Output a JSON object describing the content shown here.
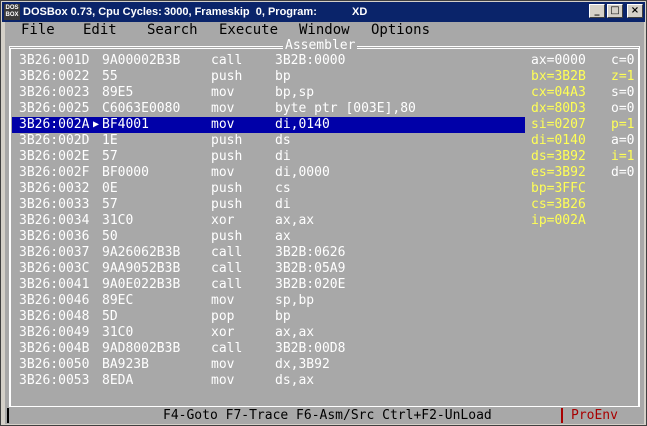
{
  "titlebar": {
    "icon_text": [
      "DOS",
      "BOX"
    ],
    "segments": [
      "DOSBox 0.73, Cpu Cycles:",
      "3000, Frameskip  0, Program:",
      "XD"
    ],
    "buttons": [
      "_",
      "□",
      "×"
    ]
  },
  "menu": [
    "File",
    "Edit",
    "Search",
    "Execute",
    "Window",
    "Options"
  ],
  "panel_title": "Assembler",
  "instructions": [
    {
      "addr": "3B26:001D",
      "bytes": "9A00002B3B",
      "mnem": "call",
      "ops": "3B2B:0000"
    },
    {
      "addr": "3B26:0022",
      "bytes": "55",
      "mnem": "push",
      "ops": "bp"
    },
    {
      "addr": "3B26:0023",
      "bytes": "89E5",
      "mnem": "mov",
      "ops": "bp,sp"
    },
    {
      "addr": "3B26:0025",
      "bytes": "C6063E0080",
      "mnem": "mov",
      "ops": "byte ptr [003E],80"
    },
    {
      "addr": "3B26:002A",
      "bytes": "BF4001",
      "mnem": "mov",
      "ops": "di,0140",
      "selected": true
    },
    {
      "addr": "3B26:002D",
      "bytes": "1E",
      "mnem": "push",
      "ops": "ds"
    },
    {
      "addr": "3B26:002E",
      "bytes": "57",
      "mnem": "push",
      "ops": "di"
    },
    {
      "addr": "3B26:002F",
      "bytes": "BF0000",
      "mnem": "mov",
      "ops": "di,0000"
    },
    {
      "addr": "3B26:0032",
      "bytes": "0E",
      "mnem": "push",
      "ops": "cs"
    },
    {
      "addr": "3B26:0033",
      "bytes": "57",
      "mnem": "push",
      "ops": "di"
    },
    {
      "addr": "3B26:0034",
      "bytes": "31C0",
      "mnem": "xor",
      "ops": "ax,ax"
    },
    {
      "addr": "3B26:0036",
      "bytes": "50",
      "mnem": "push",
      "ops": "ax"
    },
    {
      "addr": "3B26:0037",
      "bytes": "9A26062B3B",
      "mnem": "call",
      "ops": "3B2B:0626"
    },
    {
      "addr": "3B26:003C",
      "bytes": "9AA9052B3B",
      "mnem": "call",
      "ops": "3B2B:05A9"
    },
    {
      "addr": "3B26:0041",
      "bytes": "9A0E022B3B",
      "mnem": "call",
      "ops": "3B2B:020E"
    },
    {
      "addr": "3B26:0046",
      "bytes": "89EC",
      "mnem": "mov",
      "ops": "sp,bp"
    },
    {
      "addr": "3B26:0048",
      "bytes": "5D",
      "mnem": "pop",
      "ops": "bp"
    },
    {
      "addr": "3B26:0049",
      "bytes": "31C0",
      "mnem": "xor",
      "ops": "ax,ax"
    },
    {
      "addr": "3B26:004B",
      "bytes": "9AD8002B3B",
      "mnem": "call",
      "ops": "3B2B:00D8"
    },
    {
      "addr": "3B26:0050",
      "bytes": "BA923B",
      "mnem": "mov",
      "ops": "dx,3B92"
    },
    {
      "addr": "3B26:0053",
      "bytes": "8EDA",
      "mnem": "mov",
      "ops": "ds,ax"
    }
  ],
  "registers": [
    {
      "text": "ax=0000",
      "changed": false
    },
    {
      "text": "bx=3B2B",
      "changed": true
    },
    {
      "text": "cx=04A3",
      "changed": true
    },
    {
      "text": "dx=80D3",
      "changed": true
    },
    {
      "text": "si=0207",
      "changed": true
    },
    {
      "text": "di=0140",
      "changed": true
    },
    {
      "text": "ds=3B92",
      "changed": true
    },
    {
      "text": "es=3B92",
      "changed": true
    },
    {
      "text": "bp=3FFC",
      "changed": true
    },
    {
      "text": "cs=3B26",
      "changed": true
    },
    {
      "text": "ip=002A",
      "changed": true
    }
  ],
  "flags": [
    {
      "text": "c=0",
      "changed": false
    },
    {
      "text": "z=1",
      "changed": true
    },
    {
      "text": "s=0",
      "changed": false
    },
    {
      "text": "o=0",
      "changed": false
    },
    {
      "text": "p=1",
      "changed": true
    },
    {
      "text": "a=0",
      "changed": false
    },
    {
      "text": "i=1",
      "changed": true
    },
    {
      "text": "d=0",
      "changed": false
    }
  ],
  "statusbar": {
    "keys": "F4-Goto F7-Trace F6-Asm/Src Ctrl+F2-UnLoad",
    "program": "ProEnv"
  },
  "colors": {
    "highlight_bg": "#0000a8",
    "changed_value": "#ffff55",
    "screen_bg": "#a8a8a8",
    "title_bg": "#0a246a"
  }
}
